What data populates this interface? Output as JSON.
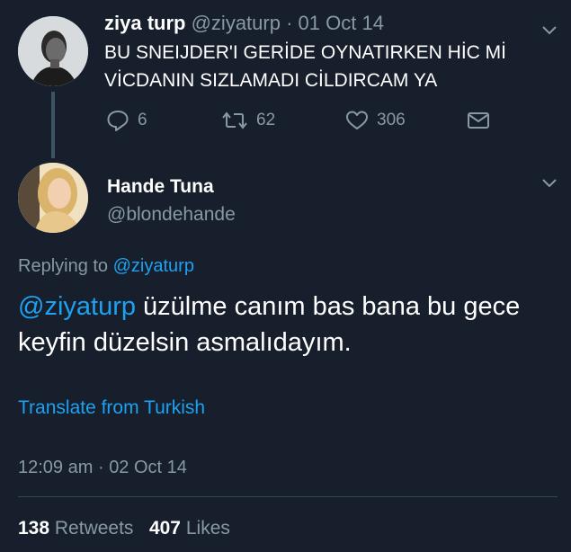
{
  "tweet1": {
    "display_name": "ziya turp",
    "handle": "@ziyaturp",
    "separator": "·",
    "date": "01 Oct 14",
    "text": "BU SNEIJDER'I GERİDE OYNATIRKEN HİC Mİ VİCDANIN SIZLAMADI CİLDIRCAM YA",
    "replies": "6",
    "retweets": "62",
    "likes": "306"
  },
  "tweet2": {
    "display_name": "Hande Tuna",
    "handle": "@blondehande",
    "replying_prefix": "Replying to",
    "replying_to": "@ziyaturp",
    "mention": "@ziyaturp",
    "text": "üzülme canım bas bana bu gece keyfin düzelsin asmalıdayım.",
    "translate": "Translate from Turkish",
    "time": "12:09 am",
    "separator": "·",
    "date": "02 Oct 14",
    "retweet_count": "138",
    "retweet_label": "Retweets",
    "like_count": "407",
    "like_label": "Likes"
  },
  "icons": {
    "reply": "reply-icon",
    "retweet": "retweet-icon",
    "like": "heart-icon",
    "dm": "envelope-icon",
    "more": "chevron-down-icon"
  },
  "colors": {
    "background": "#161f2b",
    "accent": "#1da1f2",
    "muted": "#8899a6",
    "divider": "#38444d"
  }
}
